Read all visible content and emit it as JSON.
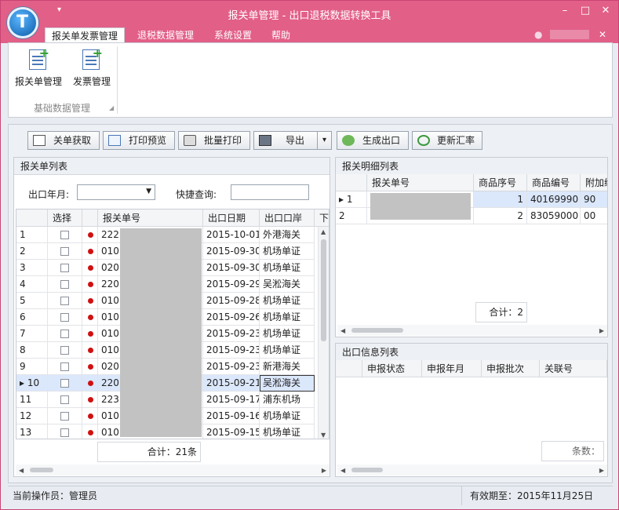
{
  "window": {
    "title": "报关单管理 - 出口退税数据转换工具",
    "logo_letter": "T",
    "min": "–",
    "max": "□",
    "close": "✕",
    "qat": "▾",
    "collapse": "✕",
    "orb": "●"
  },
  "ribbon": {
    "tabs": [
      "报关单发票管理",
      "退税数据管理",
      "系统设置",
      "帮助"
    ],
    "active_tab": 0,
    "buttons": [
      {
        "label": "报关单管理",
        "icon": "document-add-icon"
      },
      {
        "label": "发票管理",
        "icon": "invoice-add-icon"
      }
    ],
    "group_label": "基础数据管理",
    "group_launcher": "◢",
    "plus": "+"
  },
  "toolbar": {
    "buttons": [
      "关单获取",
      "打印预览",
      "批量打印",
      "导出",
      "生成出口",
      "更新汇率"
    ],
    "export_dropdown": "▾"
  },
  "customs_list": {
    "header": "报关单列表",
    "filter_month_label": "出口年月:",
    "filter_month_value": "",
    "combo_arrow": "▼",
    "quick_search_label": "快捷查询:",
    "quick_search_value": "",
    "columns": [
      "选择",
      "报关单号",
      "出口日期",
      "出口口岸",
      "下载"
    ],
    "rows": [
      {
        "n": "1",
        "no": "222",
        "date": "2015-10-01",
        "port": "外港海关"
      },
      {
        "n": "2",
        "no": "010",
        "date": "2015-09-30",
        "port": "机场单证"
      },
      {
        "n": "3",
        "no": "020",
        "date": "2015-09-30",
        "port": "机场单证"
      },
      {
        "n": "4",
        "no": "220",
        "date": "2015-09-29",
        "port": "吴淞海关"
      },
      {
        "n": "5",
        "no": "010",
        "date": "2015-09-28",
        "port": "机场单证"
      },
      {
        "n": "6",
        "no": "010",
        "date": "2015-09-26",
        "port": "机场单证"
      },
      {
        "n": "7",
        "no": "010",
        "date": "2015-09-23",
        "port": "机场单证"
      },
      {
        "n": "8",
        "no": "010",
        "date": "2015-09-23",
        "port": "机场单证"
      },
      {
        "n": "9",
        "no": "020",
        "date": "2015-09-23",
        "port": "新港海关"
      },
      {
        "n": "10",
        "no": "220",
        "date": "2015-09-21",
        "port": "吴淞海关"
      },
      {
        "n": "11",
        "no": "223",
        "date": "2015-09-17",
        "port": "浦东机场"
      },
      {
        "n": "12",
        "no": "010",
        "date": "2015-09-16",
        "port": "机场单证"
      },
      {
        "n": "13",
        "no": "010",
        "date": "2015-09-15",
        "port": "机场单证"
      }
    ],
    "current_row_marker": "▸",
    "total": "合计：21条",
    "scroll_up": "▲",
    "scroll_down": "▼",
    "scroll_left": "◀",
    "scroll_right": "▶"
  },
  "detail_list": {
    "header": "报关明细列表",
    "columns": [
      "报关单号",
      "商品序号",
      "商品编号",
      "附加编"
    ],
    "rows": [
      {
        "n": "1",
        "seq": "1",
        "code": "40169990",
        "extra": "90"
      },
      {
        "n": "2",
        "seq": "2",
        "code": "83059000",
        "extra": "00"
      }
    ],
    "current_row_marker": "▸",
    "total": "合计：2",
    "scroll_left": "◀",
    "scroll_right": "▶"
  },
  "export_info": {
    "header": "出口信息列表",
    "columns": [
      "申报状态",
      "申报年月",
      "申报批次",
      "关联号"
    ],
    "count_label": "条数：",
    "scroll_left": "◀",
    "scroll_right": "▶"
  },
  "status": {
    "operator": "当前操作员：管理员",
    "expiry": "有效期至：2015年11月25日"
  }
}
